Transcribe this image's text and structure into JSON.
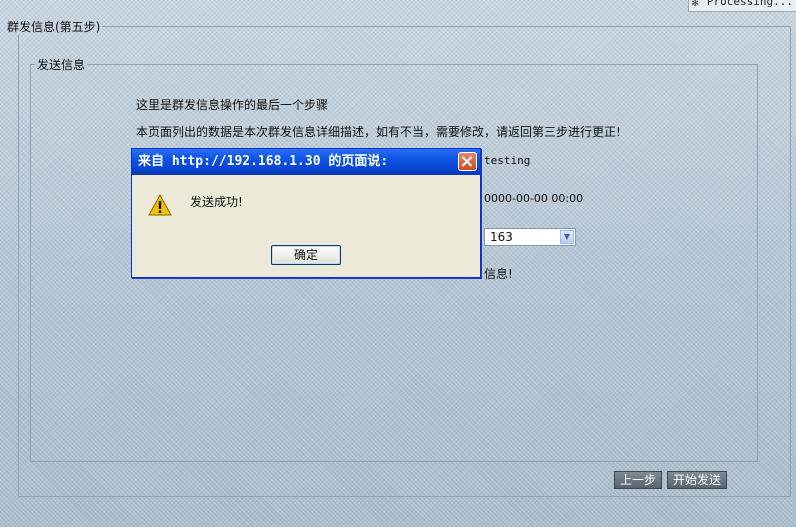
{
  "processing_label": "Processing...",
  "outer_legend": "群发信息(第五步)",
  "inner_legend": "发送信息",
  "content": {
    "line1": "这里是群发信息操作的最后一个步骤",
    "line2": "本页面列出的数据是本次群发信息详细描述，如有不当，需要修改，请返回第三步进行更正!",
    "value_title": "testing",
    "value_time": "0000-00-00 00:00",
    "select_value": "163",
    "trailing_text": "信息!"
  },
  "buttons": {
    "prev_label": "上一步",
    "send_label": "开始发送"
  },
  "dialog": {
    "title": "来自 http://192.168.1.30 的页面说:",
    "message": "发送成功!",
    "ok_label": "确定"
  },
  "colors": {
    "titlebar": "#0a47d6",
    "dialog_bg": "#ece9d8",
    "close_button": "#c74a28",
    "warning_icon": "#f2c200"
  }
}
